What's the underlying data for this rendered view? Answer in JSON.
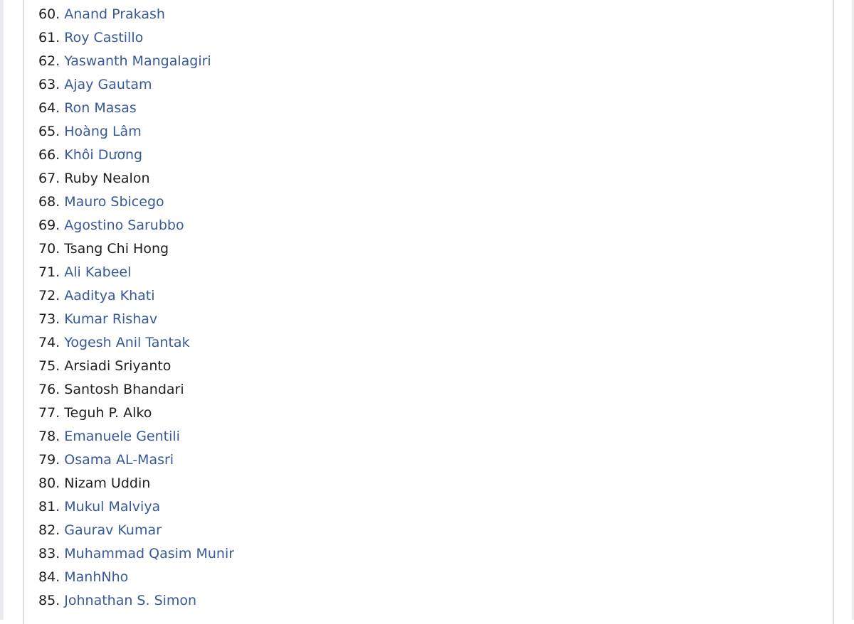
{
  "colors": {
    "link": "#385898",
    "text": "#1c1e21"
  },
  "list": [
    {
      "n": "60.",
      "name": "Anand Prakash",
      "link": true
    },
    {
      "n": "61.",
      "name": "Roy Castillo",
      "link": true
    },
    {
      "n": "62.",
      "name": "Yaswanth Mangalagiri",
      "link": true
    },
    {
      "n": "63.",
      "name": "Ajay Gautam",
      "link": true
    },
    {
      "n": "64.",
      "name": "Ron Masas",
      "link": true
    },
    {
      "n": "65.",
      "name": "Hoàng Lâm",
      "link": true
    },
    {
      "n": "66.",
      "name": "Khôi Dương",
      "link": true
    },
    {
      "n": "67.",
      "name": "Ruby Nealon",
      "link": false
    },
    {
      "n": "68.",
      "name": "Mauro Sbicego",
      "link": true
    },
    {
      "n": "69.",
      "name": "Agostino Sarubbo",
      "link": true
    },
    {
      "n": "70.",
      "name": "Tsang Chi Hong",
      "link": false
    },
    {
      "n": "71.",
      "name": "Ali Kabeel",
      "link": true
    },
    {
      "n": "72.",
      "name": "Aaditya Khati",
      "link": true
    },
    {
      "n": "73.",
      "name": "Kumar Rishav",
      "link": true
    },
    {
      "n": "74.",
      "name": "Yogesh Anil Tantak",
      "link": true
    },
    {
      "n": "75.",
      "name": "Arsiadi Sriyanto",
      "link": false
    },
    {
      "n": "76.",
      "name": "Santosh Bhandari",
      "link": false
    },
    {
      "n": "77.",
      "name": "Teguh P. Alko",
      "link": false
    },
    {
      "n": "78.",
      "name": "Emanuele Gentili",
      "link": true
    },
    {
      "n": "79.",
      "name": "Osama AL-Masri",
      "link": true
    },
    {
      "n": "80.",
      "name": "Nizam Uddin",
      "link": false
    },
    {
      "n": "81.",
      "name": "Mukul Malviya",
      "link": true
    },
    {
      "n": "82.",
      "name": "Gaurav Kumar",
      "link": true
    },
    {
      "n": "83.",
      "name": "Muhammad Qasim Munir",
      "link": true
    },
    {
      "n": "84.",
      "name": "ManhNho",
      "link": true
    },
    {
      "n": "85.",
      "name": "Johnathan S. Simon",
      "link": true
    }
  ]
}
